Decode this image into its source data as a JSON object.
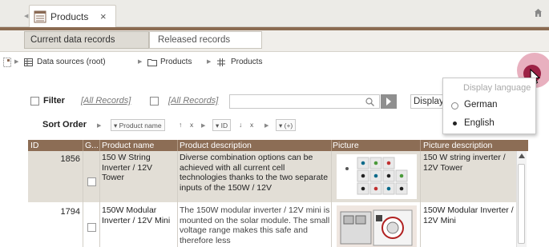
{
  "tabs": {
    "main_tab_label": "Products",
    "close_symbol": "×",
    "subtabs": [
      "Current data records",
      "Released records"
    ]
  },
  "breadcrumb": {
    "items": [
      "Data sources (root)",
      "Products",
      "Products"
    ]
  },
  "filter": {
    "label": "Filter",
    "link1": "[All Records]",
    "link2": "[All Records]",
    "search_value": "",
    "display_field_value": "Display language"
  },
  "sort": {
    "label": "Sort Order",
    "criteria": [
      {
        "field": "Product name",
        "dir": "↑"
      },
      {
        "field": "ID",
        "dir": "↓"
      },
      {
        "field": "(+)"
      }
    ]
  },
  "grid": {
    "columns": [
      "ID",
      "G...",
      "Product name",
      "Product description",
      "Picture",
      "Picture description"
    ],
    "rows": [
      {
        "id": "1856",
        "name": "150 W String Inverter / 12V Tower",
        "description": "Diverse combination options can be achieved with all current cell technologies thanks to the two separate inputs of the 150W / 12V",
        "picture_description": "150 W string inverter / 12V Tower"
      },
      {
        "id": "1794",
        "name": "150W Modular Inverter / 12V Mini",
        "description": "The 150W modular inverter / 12V mini is mounted on the solar module. The small voltage range makes this safe and therefore less",
        "picture_description": "150W Modular Inverter / 12V Mini"
      }
    ]
  },
  "language_menu": {
    "title": "Display language",
    "options": [
      {
        "label": "German",
        "state": "radio"
      },
      {
        "label": "English",
        "state": "selected"
      }
    ]
  },
  "colors": {
    "brand_brown": "#8b6b52",
    "accent_button": "#9c2245"
  },
  "icons": [
    "table-icon",
    "home-icon",
    "folder-icon",
    "grid-icon",
    "search-icon",
    "arrow-right-icon",
    "gear-icon",
    "cursor-icon"
  ]
}
